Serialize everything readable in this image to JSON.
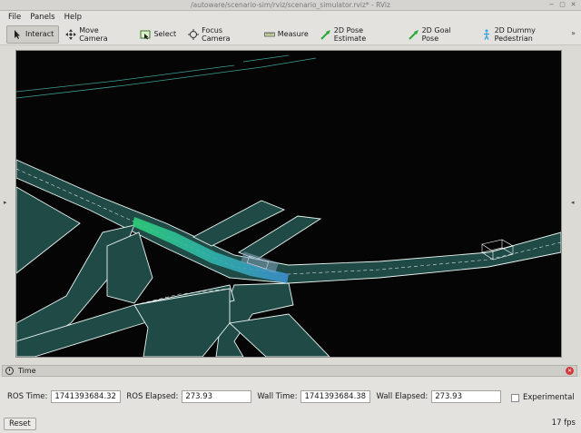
{
  "window": {
    "title": "/autoware/scenario-sim/rviz/scenario_simulator.rviz* - RViz",
    "buttons": {
      "minimize": "−",
      "maximize": "▢",
      "close": "✕"
    }
  },
  "menu": [
    {
      "label": "File",
      "mnemonic": "F"
    },
    {
      "label": "Panels",
      "mnemonic": "P"
    },
    {
      "label": "Help",
      "mnemonic": "H"
    }
  ],
  "toolbar": {
    "tools": [
      {
        "label": "Interact",
        "icon": "interact-icon",
        "active": true
      },
      {
        "label": "Move Camera",
        "icon": "move-camera-icon"
      },
      {
        "label": "Select",
        "icon": "select-icon"
      },
      {
        "label": "Focus Camera",
        "icon": "focus-camera-icon"
      },
      {
        "label": "Measure",
        "icon": "measure-icon"
      },
      {
        "label": "2D Pose Estimate",
        "icon": "pose-estimate-icon"
      },
      {
        "label": "2D Goal Pose",
        "icon": "goal-pose-icon"
      },
      {
        "label": "2D Dummy Pedestrian",
        "icon": "pedestrian-icon"
      }
    ],
    "overflow": "»"
  },
  "panels": {
    "left_arrow": "▸",
    "right_arrow": "◂"
  },
  "time_panel": {
    "title": "Time",
    "ros_time_label": "ROS Time:",
    "ros_time": "1741393684.32",
    "ros_elapsed_label": "ROS Elapsed:",
    "ros_elapsed": "273.93",
    "wall_time_label": "Wall Time:",
    "wall_time": "1741393684.38",
    "wall_elapsed_label": "Wall Elapsed:",
    "wall_elapsed": "273.93",
    "experimental_label": "Experimental",
    "experimental_checked": false,
    "reset_label": "Reset",
    "fps": "17 fps"
  },
  "colors": {
    "lane_fill": "#1f4a45",
    "lane_edge": "#e8f5f3",
    "route_green": "#2fd07a",
    "route_blue": "#3d8fd0",
    "viewport_bg": "#050505"
  }
}
